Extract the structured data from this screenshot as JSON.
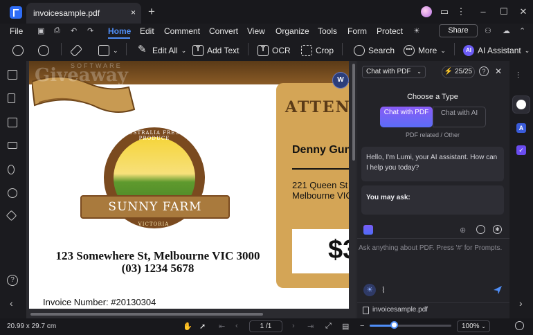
{
  "title_bar": {
    "tab_name": "invoicesample.pdf",
    "close_glyph": "×",
    "new_tab_glyph": "+",
    "window_controls": {
      "minimize": "–",
      "maximize": "☐",
      "close": "✕"
    }
  },
  "menu": {
    "items": [
      "File",
      "Home",
      "Edit",
      "Comment",
      "Convert",
      "View",
      "Organize",
      "Tools",
      "Form",
      "Protect"
    ],
    "active": "Home",
    "share_label": "Share",
    "accent_color": "#4f8ef7"
  },
  "toolbar": {
    "edit_all": "Edit All",
    "add_text": "Add Text",
    "ocr": "OCR",
    "crop": "Crop",
    "search": "Search",
    "more": "More",
    "ai_assistant": "AI Assistant",
    "ai_badge": "AI"
  },
  "document": {
    "watermark": "Giveaway",
    "watermark_sub": "SOFTWARE",
    "logo_top_text": "AUSTRALIA FRESH PRODUCE",
    "logo_name": "SUNNY FARM",
    "logo_bottom_text": "VICTORIA",
    "address_line1": "123 Somewhere St, Melbourne VIC 3000",
    "address_line2": "(03) 1234 5678",
    "invoice_number": "Invoice Number: #20130304",
    "attention_title": "ATTENTI",
    "recipient_name": "Denny Gun",
    "recipient_street": "221 Queen St",
    "recipient_city": "Melbourne VIC",
    "amount_partial": "$3",
    "word_badge": "W"
  },
  "ai_panel": {
    "mode_select": "Chat with PDF",
    "credits": "25/25",
    "choose_type": "Choose a Type",
    "type_pdf": "Chat with PDF",
    "type_ai": "Chat with AI",
    "type_caption": "PDF related / Other",
    "greeting": "Hello, I'm Lumi, your AI assistant. How can I help you today?",
    "you_may_ask": "You may ask:",
    "prompt_placeholder": "Ask anything about PDF. Press '#' for Prompts.",
    "file_name": "invoicesample.pdf"
  },
  "status_bar": {
    "page_size": "20.99 x 29.7 cm",
    "page_indicator": "1 /1",
    "zoom": "100%",
    "zoom_fraction": 0.3
  }
}
